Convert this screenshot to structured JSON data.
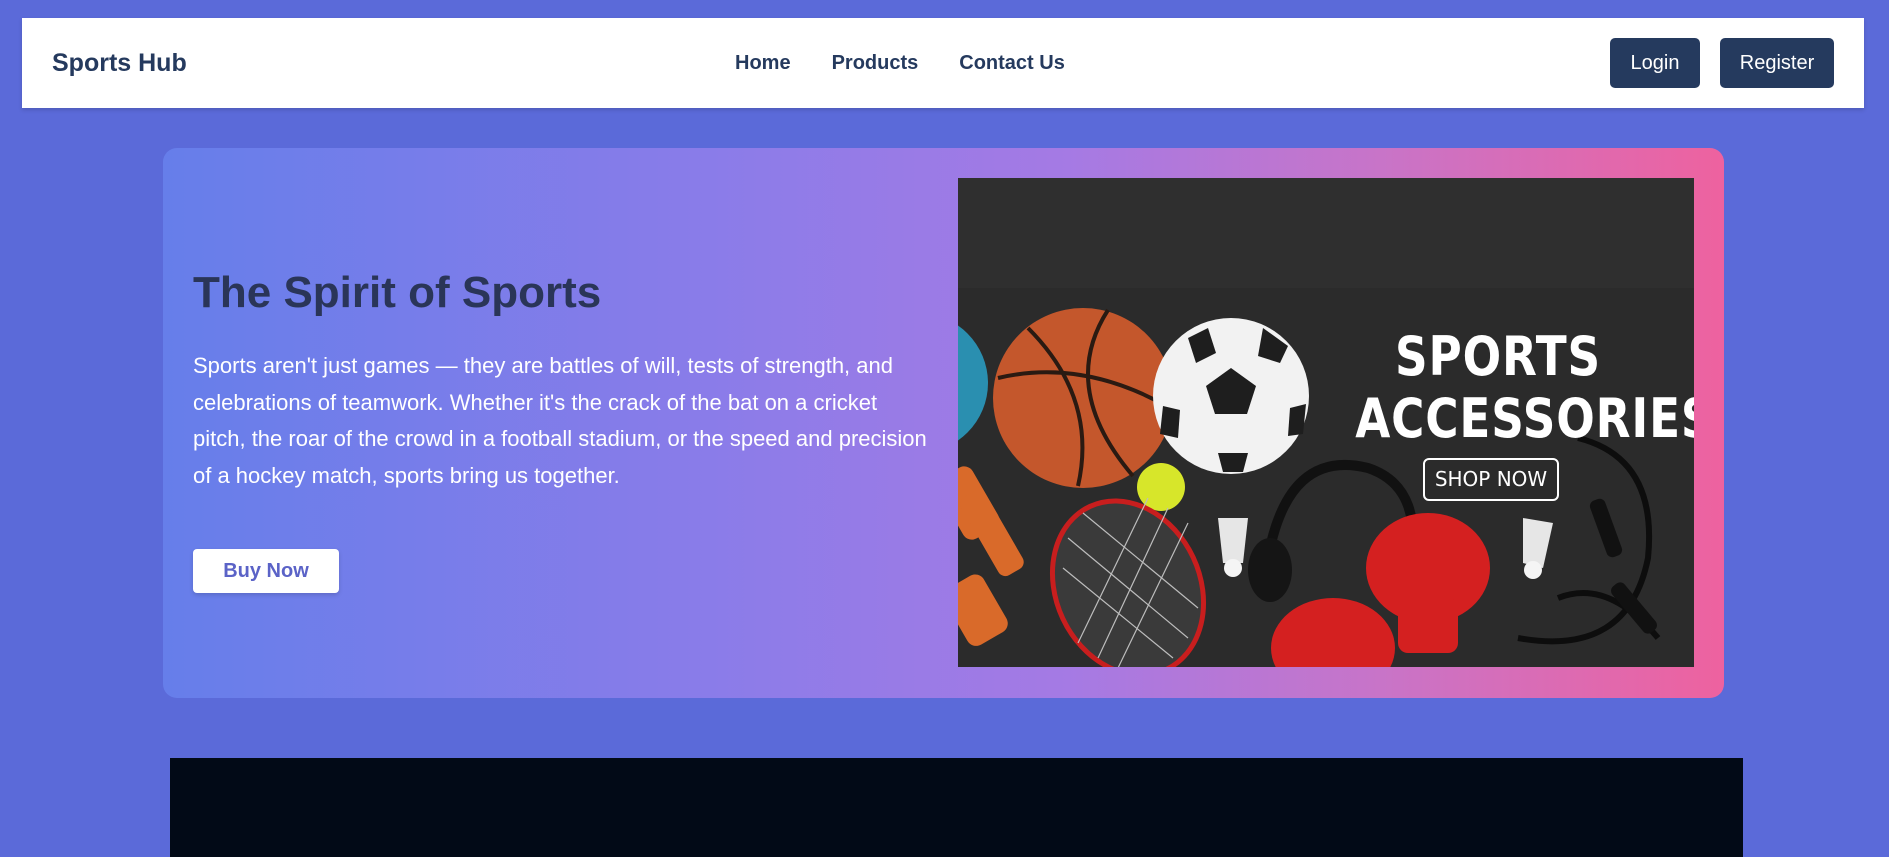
{
  "navbar": {
    "brand": "Sports Hub",
    "links": [
      "Home",
      "Products",
      "Contact Us"
    ],
    "login_label": "Login",
    "register_label": "Register"
  },
  "hero": {
    "title": "The Spirit of Sports",
    "text": "Sports aren't just games — they are battles of will, tests of strength, and celebrations of teamwork. Whether it's the crack of the bat on a cricket pitch, the roar of the crowd in a football stadium, or the speed and precision of a hockey match, sports bring us together.",
    "buy_label": "Buy Now"
  },
  "banner": {
    "title_line1": "SPORTS",
    "title_line2": "ACCESSORIES",
    "shop_label": "SHOP NOW"
  },
  "colors": {
    "page_bg": "#5b6ad9",
    "navy": "#253a5e",
    "gradient_start": "#667eea",
    "gradient_end": "#ee629f"
  }
}
